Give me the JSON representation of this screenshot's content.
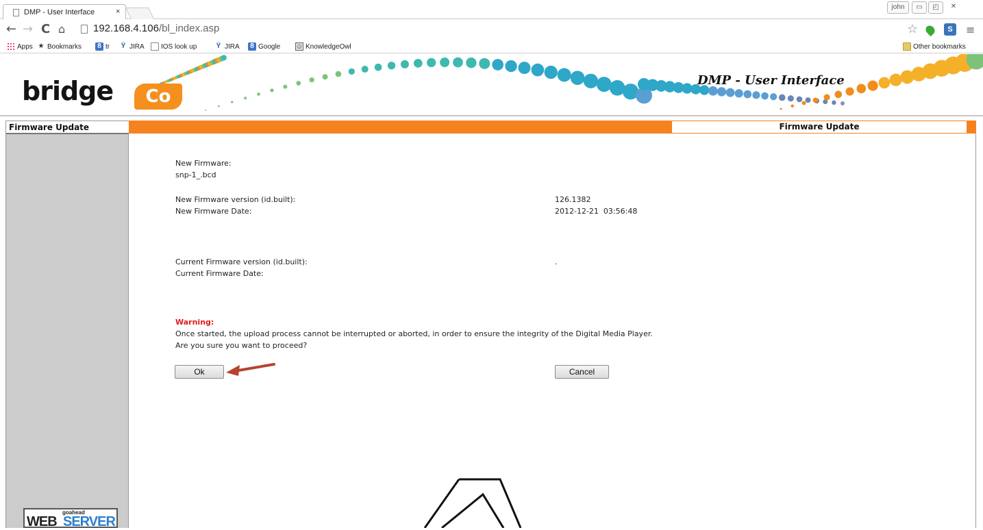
{
  "browser": {
    "tab_title": "DMP - User Interface",
    "tab_close": "×",
    "user_badge": "john",
    "url_host": "192.168.4.106",
    "url_path": "/bl_index.asp",
    "bookmarks": [
      {
        "label": "Apps",
        "icon": "apps-grid-icon"
      },
      {
        "label": "Bookmarks",
        "icon": "star-icon"
      },
      {
        "label": "tr",
        "icon": "google-translate-icon"
      },
      {
        "label": "JIRA",
        "icon": "jira-icon"
      },
      {
        "label": "IOS look up",
        "icon": "page-icon"
      },
      {
        "label": "JIRA",
        "icon": "jira-icon"
      },
      {
        "label": "Google",
        "icon": "google-icon"
      },
      {
        "label": "KnowledgeOwl",
        "icon": "owl-icon"
      }
    ],
    "other_bookmarks": "Other bookmarks"
  },
  "header": {
    "logo_text": "bridge",
    "logo_co": "Co",
    "title": "DMP - User Interface"
  },
  "sidebar": {
    "heading": "Firmware Update",
    "footer_small": "goahead",
    "footer_web": "WEB",
    "footer_server": "SERVER"
  },
  "content": {
    "tab_title": "Firmware Update",
    "new_firmware_label": "New Firmware:",
    "new_firmware_file": "snp-1_.bcd",
    "new_version_label": "New Firmware version (id.built):",
    "new_version_value": "126.1382",
    "new_date_label": "New Firmware Date:",
    "new_date_value": "2012-12-21  03:56:48",
    "current_version_label": "Current Firmware version (id.built):",
    "current_version_value": ".",
    "current_date_label": "Current Firmware Date:",
    "warning_title": "Warning:",
    "warning_text": "Once started, the upload process cannot be interrupted or aborted, in order to ensure the integrity of the Digital Media Player.",
    "confirm_text": "Are you sure you want to proceed?",
    "ok_label": "Ok",
    "cancel_label": "Cancel"
  },
  "colors": {
    "accent_orange": "#f5821f",
    "warning_red": "#e01b1b",
    "sidebar_gray": "#cccccc",
    "annotation_arrow": "#b5432f"
  }
}
